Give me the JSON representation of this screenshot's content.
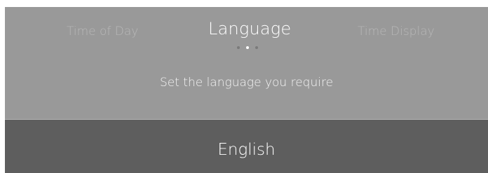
{
  "header": {
    "tabs": [
      {
        "label": "Time of Day"
      },
      {
        "label": "Language"
      },
      {
        "label": "Time Display"
      }
    ],
    "active_tab_index": 1,
    "page_indicator": {
      "count": 3,
      "active_index": 1
    }
  },
  "prompt": {
    "text": "Set the language you require"
  },
  "list": {
    "items": [
      {
        "label": "English"
      }
    ]
  },
  "colors": {
    "panel_background": "#999999",
    "list_background": "#5e5e5e",
    "active_text": "#ffffff",
    "inactive_text": "#b8b8b8"
  }
}
